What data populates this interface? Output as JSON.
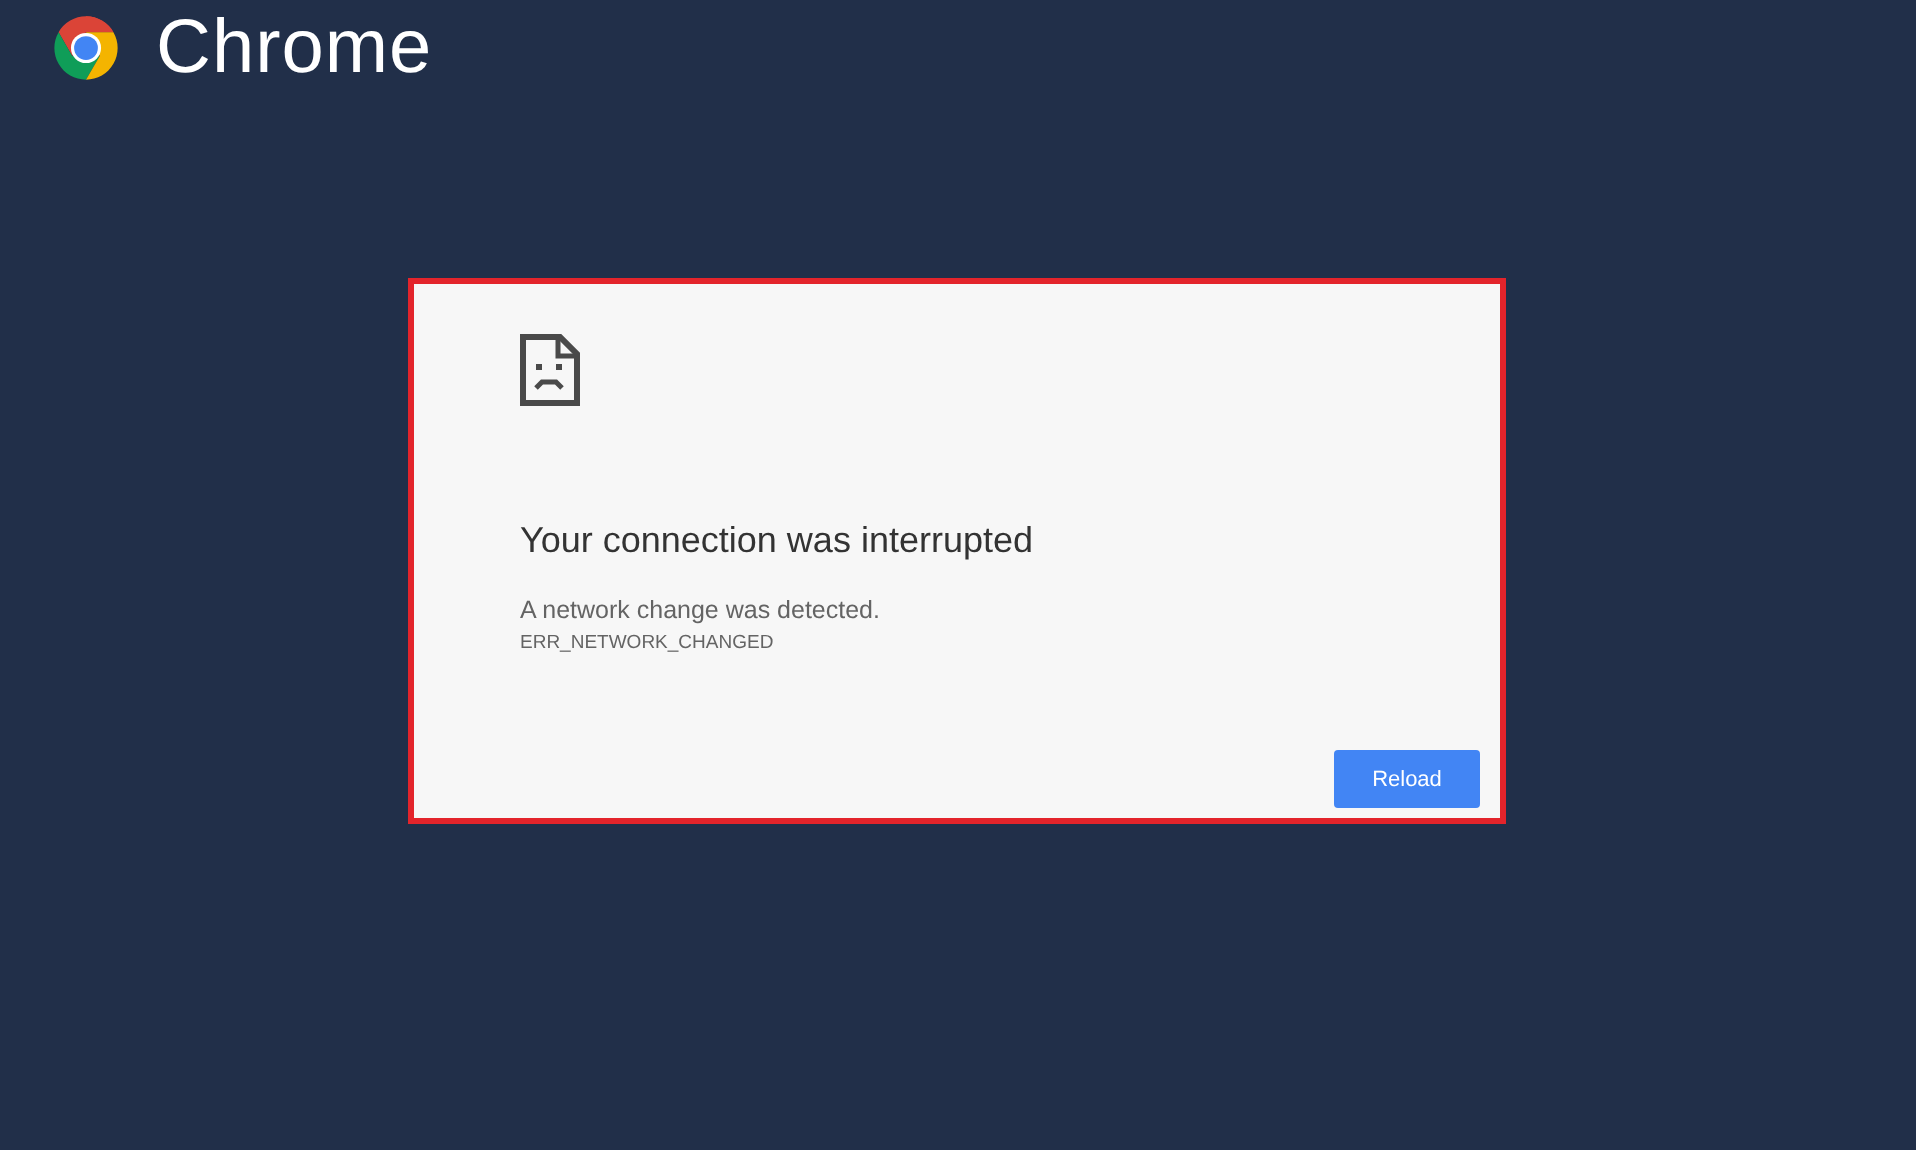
{
  "brand": {
    "name": "Chrome"
  },
  "error_page": {
    "title": "Your connection was interrupted",
    "message": "A network change was detected.",
    "error_code": "ERR_NETWORK_CHANGED",
    "button": "Reload"
  }
}
